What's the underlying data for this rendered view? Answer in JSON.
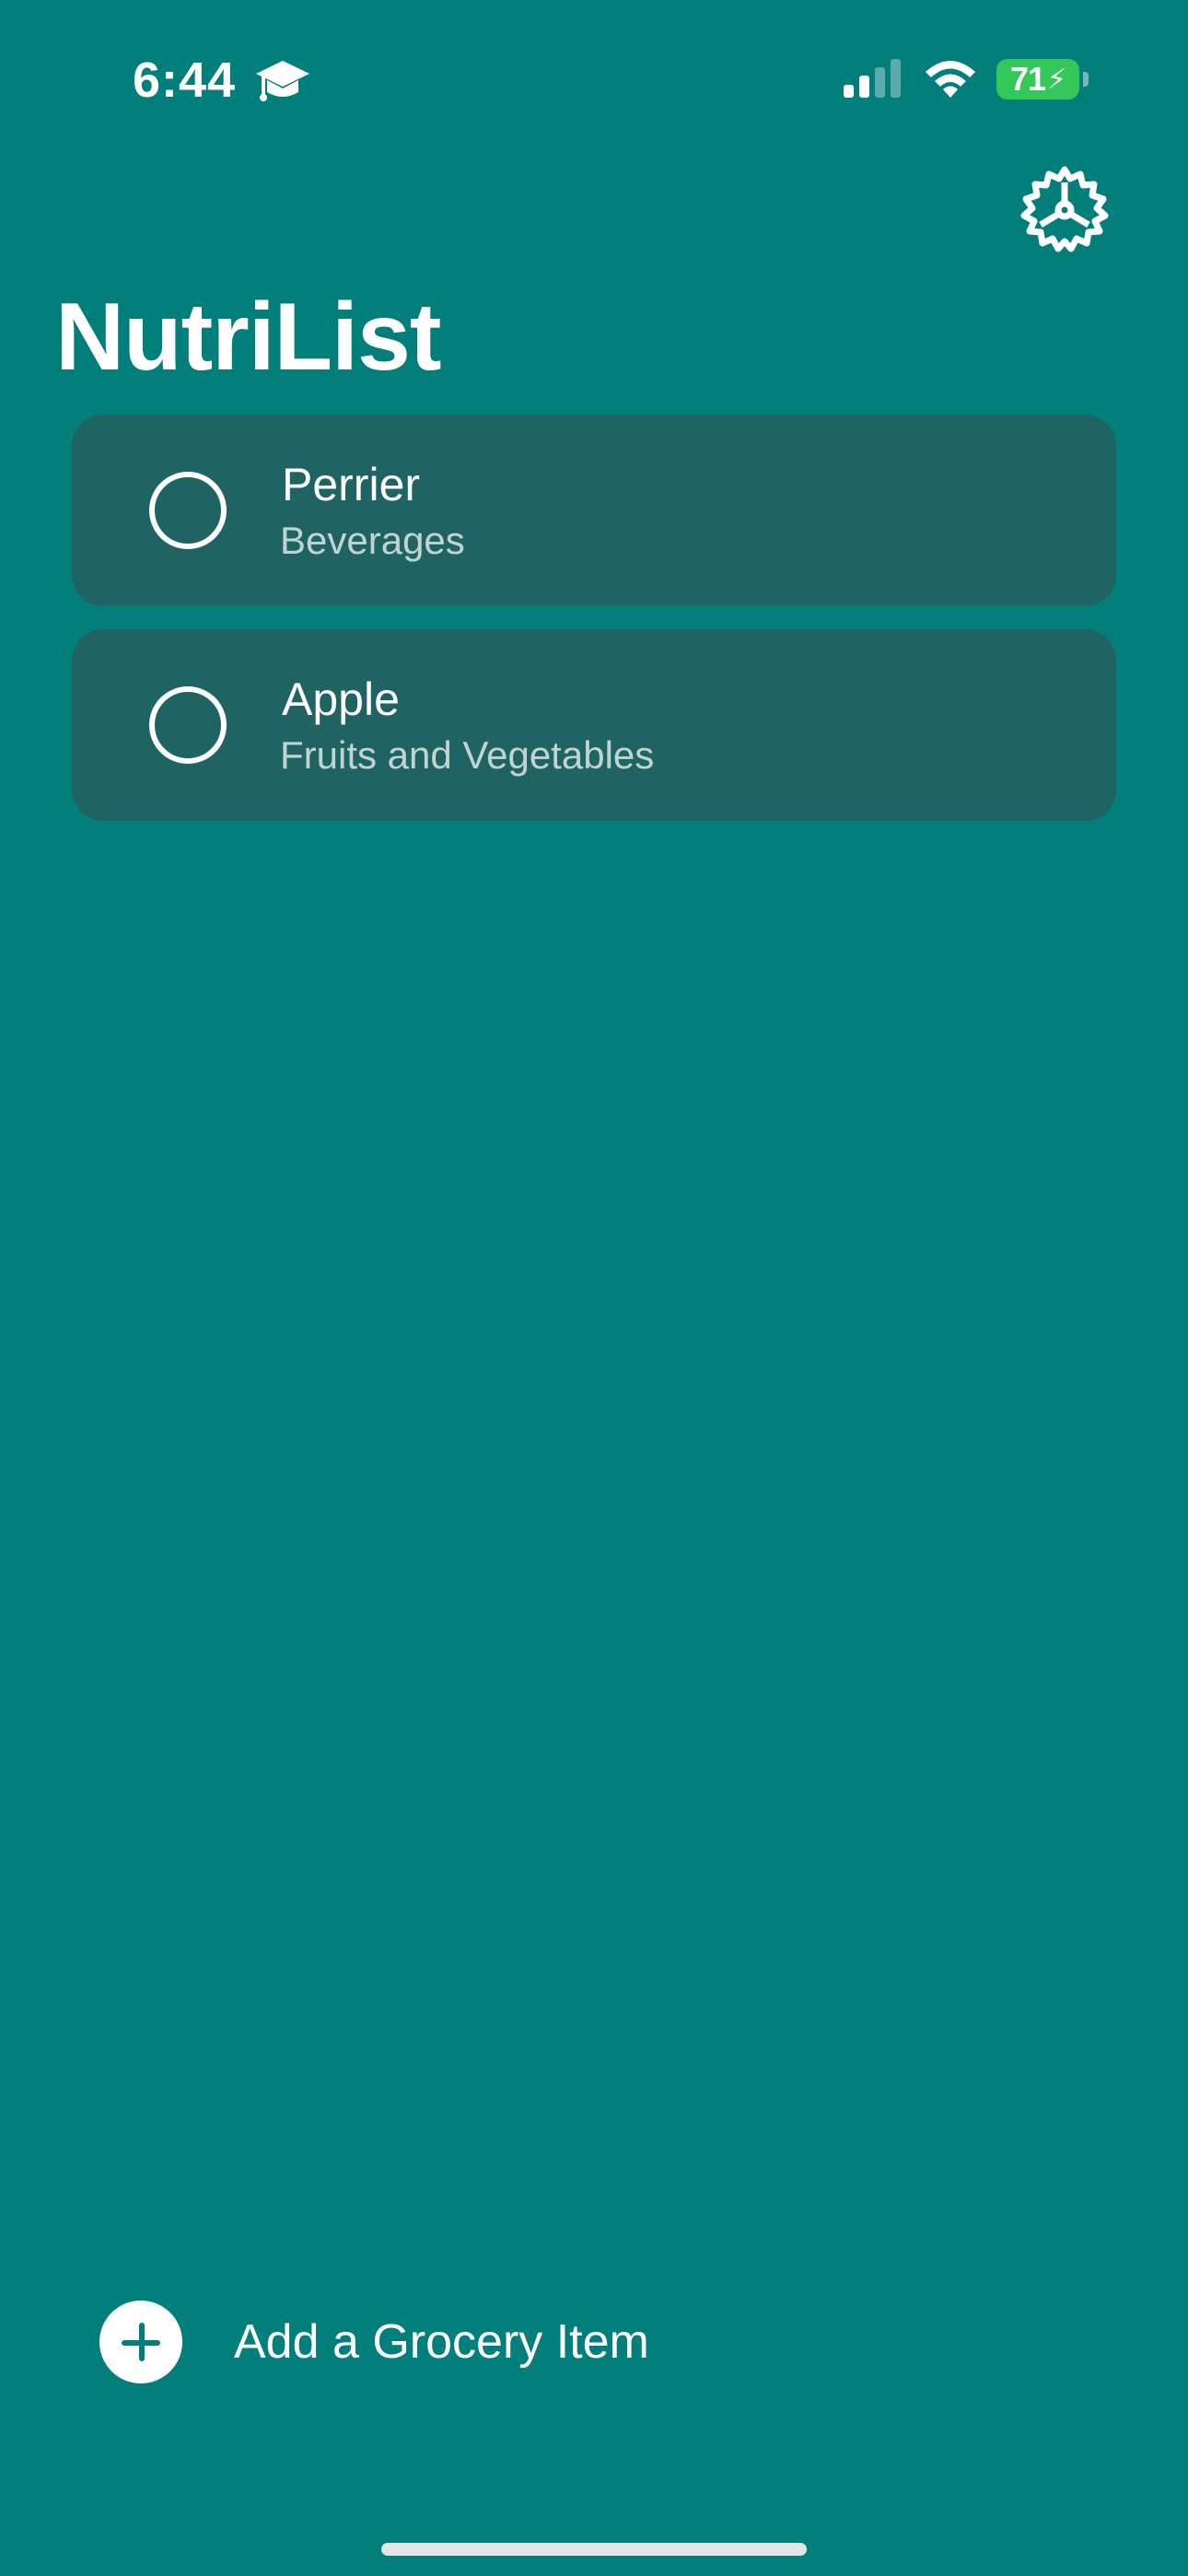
{
  "status_bar": {
    "time": "6:44",
    "battery_level": "71",
    "battery_color": "#34C759",
    "icons": [
      "graduation-cap-icon",
      "cellular-signal-icon",
      "wifi-icon",
      "battery-charging-icon"
    ]
  },
  "header": {
    "title": "NutriList",
    "settings_icon": "gear-icon"
  },
  "grocery_items": [
    {
      "name": "Perrier",
      "category": "Beverages",
      "checked": false
    },
    {
      "name": "Apple",
      "category": "Fruits and Vegetables",
      "checked": false
    }
  ],
  "footer": {
    "add_label": "Add a Grocery Item",
    "add_icon": "plus-circle-icon"
  },
  "colors": {
    "background": "#027F7B",
    "card": "#1F6462",
    "text": "#FFFFFF"
  }
}
